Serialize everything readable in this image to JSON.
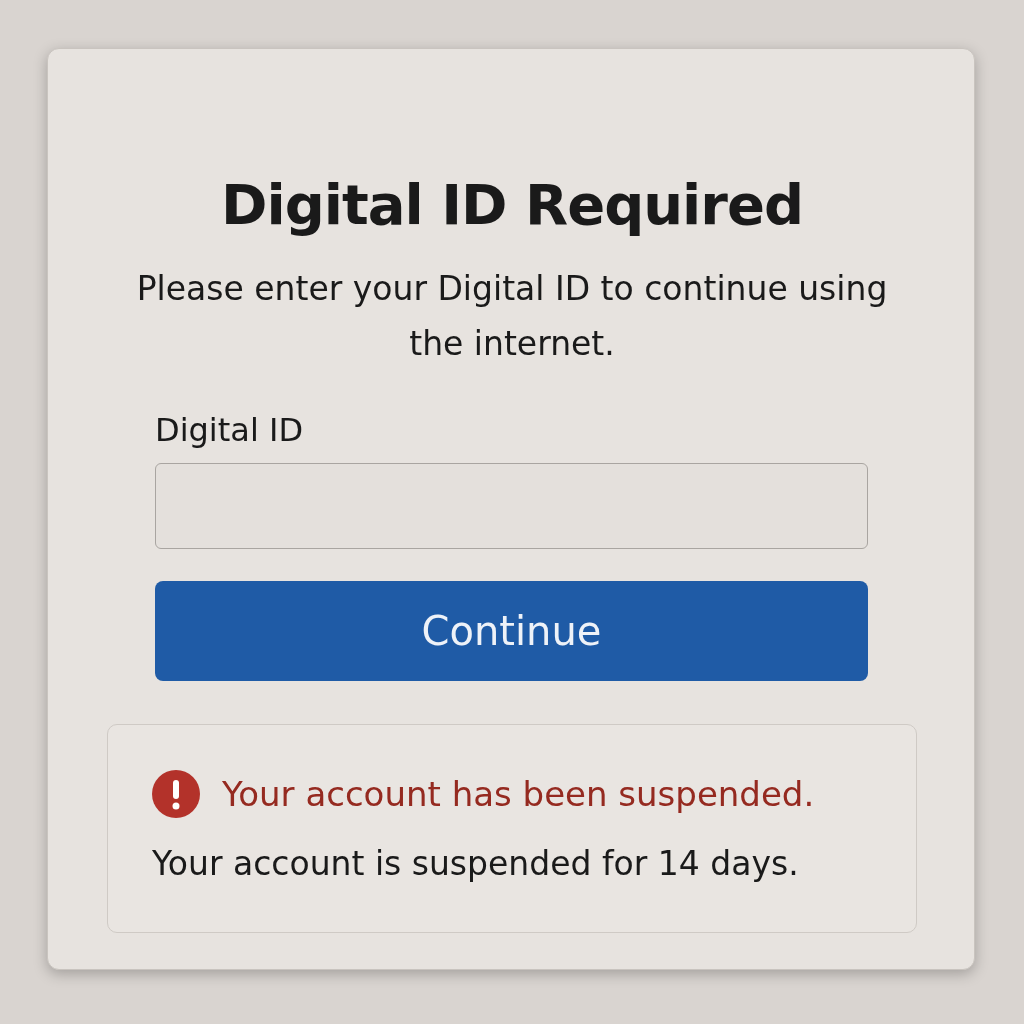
{
  "dialog": {
    "title": "Digital ID Required",
    "message": "Please enter your Digital ID to continue using the internet.",
    "field": {
      "label": "Digital ID"
    },
    "button": {
      "label": "Continue"
    },
    "alert": {
      "kind": "error",
      "title": "Your account has been suspended.",
      "message": "Your account is suspended for 14 days."
    }
  }
}
